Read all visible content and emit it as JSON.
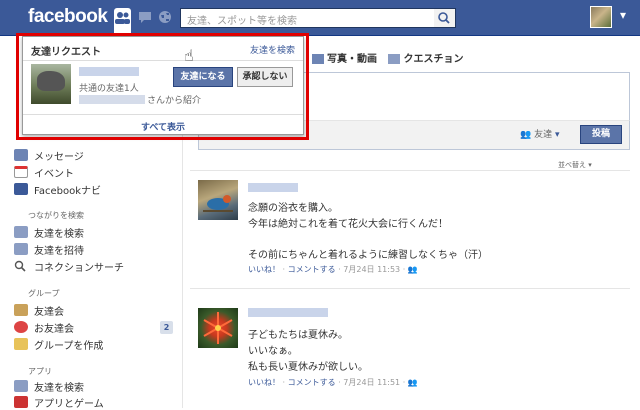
{
  "topbar": {
    "logo": "facebook",
    "search_placeholder": "友達、スポット等を検索"
  },
  "popup": {
    "title": "友達リクエスト",
    "find_friends": "友達を検索",
    "mutual": "共通の友達1人",
    "intro_suffix": "さんから紹介",
    "confirm": "友達になる",
    "deny": "承認しない",
    "see_all": "すべて表示"
  },
  "composer": {
    "photo_label": "写真・動画",
    "question_label": "クエスチョン",
    "audience": "友達",
    "post_button": "投稿"
  },
  "sidebar": {
    "items_top": [
      {
        "label": "メッセージ"
      },
      {
        "label": "イベント"
      },
      {
        "label": "Facebookナビ"
      }
    ],
    "section_connect": "つながりを検索",
    "items_connect": [
      {
        "label": "友達を検索"
      },
      {
        "label": "友達を招待"
      },
      {
        "label": "コネクションサーチ"
      }
    ],
    "section_groups": "グループ",
    "items_groups": [
      {
        "label": "友達会"
      },
      {
        "label": "お友達会",
        "badge": "2"
      },
      {
        "label": "グループを作成"
      }
    ],
    "section_apps": "アプリ",
    "items_apps": [
      {
        "label": "友達を検索"
      },
      {
        "label": "アプリとゲーム"
      }
    ]
  },
  "feed": {
    "sort_label": "並べ替え ▾",
    "stories": [
      {
        "lines": [
          "念願の浴衣を購入。",
          "今年は絶対これを着て花火大会に行くんだ！",
          "",
          "その前にちゃんと着れるように練習しなくちゃ（汗）"
        ],
        "like": "いいね！",
        "comment": "コメントする",
        "time": "7月24日 11:53"
      },
      {
        "lines": [
          "子どもたちは夏休み。",
          "いいなぁ。",
          "私も長い夏休みが欲しい。"
        ],
        "like": "いいね！",
        "comment": "コメントする",
        "time": "7月24日 11:51"
      }
    ]
  },
  "colors": {
    "brand": "#3b5998",
    "highlight": "#e00000"
  }
}
